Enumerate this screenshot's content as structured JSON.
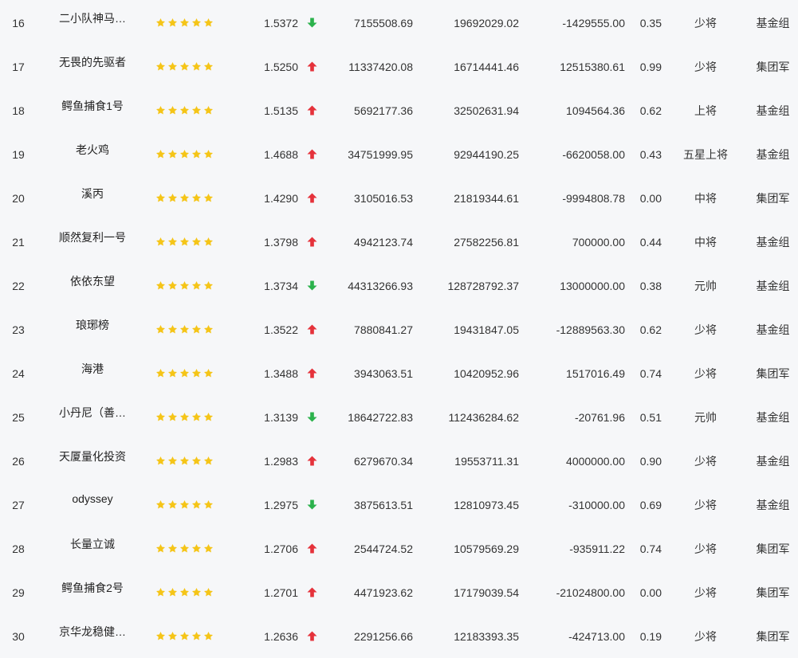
{
  "table": {
    "colors": {
      "star": "#f5c518",
      "up": "#e5323b",
      "down": "#2bb24c",
      "text": "#333333",
      "background": "#f6f7f9"
    },
    "rows": [
      {
        "rank": "16",
        "name": "二小队神马…",
        "rating": 5,
        "nav": "1.5372",
        "trend": "down",
        "asset": "7155508.69",
        "total": "19692029.02",
        "flow": "-1429555.00",
        "ratio": "0.35",
        "level": "少将",
        "group": "基金组"
      },
      {
        "rank": "17",
        "name": "无畏的先驱者",
        "rating": 5,
        "nav": "1.5250",
        "trend": "up",
        "asset": "11337420.08",
        "total": "16714441.46",
        "flow": "12515380.61",
        "ratio": "0.99",
        "level": "少将",
        "group": "集团军"
      },
      {
        "rank": "18",
        "name": "鳄鱼捕食1号",
        "rating": 5,
        "nav": "1.5135",
        "trend": "up",
        "asset": "5692177.36",
        "total": "32502631.94",
        "flow": "1094564.36",
        "ratio": "0.62",
        "level": "上将",
        "group": "基金组"
      },
      {
        "rank": "19",
        "name": "老火鸡",
        "rating": 5,
        "nav": "1.4688",
        "trend": "up",
        "asset": "34751999.95",
        "total": "92944190.25",
        "flow": "-6620058.00",
        "ratio": "0.43",
        "level": "五星上将",
        "group": "基金组"
      },
      {
        "rank": "20",
        "name": "溪丙",
        "rating": 5,
        "nav": "1.4290",
        "trend": "up",
        "asset": "3105016.53",
        "total": "21819344.61",
        "flow": "-9994808.78",
        "ratio": "0.00",
        "level": "中将",
        "group": "集团军"
      },
      {
        "rank": "21",
        "name": "顺然复利一号",
        "rating": 5,
        "nav": "1.3798",
        "trend": "up",
        "asset": "4942123.74",
        "total": "27582256.81",
        "flow": "700000.00",
        "ratio": "0.44",
        "level": "中将",
        "group": "基金组"
      },
      {
        "rank": "22",
        "name": "依依东望",
        "rating": 5,
        "nav": "1.3734",
        "trend": "down",
        "asset": "44313266.93",
        "total": "128728792.37",
        "flow": "13000000.00",
        "ratio": "0.38",
        "level": "元帅",
        "group": "基金组"
      },
      {
        "rank": "23",
        "name": "琅琊榜",
        "rating": 5,
        "nav": "1.3522",
        "trend": "up",
        "asset": "7880841.27",
        "total": "19431847.05",
        "flow": "-12889563.30",
        "ratio": "0.62",
        "level": "少将",
        "group": "基金组"
      },
      {
        "rank": "24",
        "name": "海港",
        "rating": 5,
        "nav": "1.3488",
        "trend": "up",
        "asset": "3943063.51",
        "total": "10420952.96",
        "flow": "1517016.49",
        "ratio": "0.74",
        "level": "少将",
        "group": "集团军"
      },
      {
        "rank": "25",
        "name": "小丹尼（善…",
        "rating": 5,
        "nav": "1.3139",
        "trend": "down",
        "asset": "18642722.83",
        "total": "112436284.62",
        "flow": "-20761.96",
        "ratio": "0.51",
        "level": "元帅",
        "group": "基金组"
      },
      {
        "rank": "26",
        "name": "天厦量化投资",
        "rating": 5,
        "nav": "1.2983",
        "trend": "up",
        "asset": "6279670.34",
        "total": "19553711.31",
        "flow": "4000000.00",
        "ratio": "0.90",
        "level": "少将",
        "group": "基金组"
      },
      {
        "rank": "27",
        "name": "odyssey",
        "rating": 5,
        "nav": "1.2975",
        "trend": "down",
        "asset": "3875613.51",
        "total": "12810973.45",
        "flow": "-310000.00",
        "ratio": "0.69",
        "level": "少将",
        "group": "基金组"
      },
      {
        "rank": "28",
        "name": "长量立诚",
        "rating": 5,
        "nav": "1.2706",
        "trend": "up",
        "asset": "2544724.52",
        "total": "10579569.29",
        "flow": "-935911.22",
        "ratio": "0.74",
        "level": "少将",
        "group": "集团军"
      },
      {
        "rank": "29",
        "name": "鳄鱼捕食2号",
        "rating": 5,
        "nav": "1.2701",
        "trend": "up",
        "asset": "4471923.62",
        "total": "17179039.54",
        "flow": "-21024800.00",
        "ratio": "0.00",
        "level": "少将",
        "group": "集团军"
      },
      {
        "rank": "30",
        "name": "京华龙稳健…",
        "rating": 5,
        "nav": "1.2636",
        "trend": "up",
        "asset": "2291256.66",
        "total": "12183393.35",
        "flow": "-424713.00",
        "ratio": "0.19",
        "level": "少将",
        "group": "集团军"
      }
    ]
  }
}
